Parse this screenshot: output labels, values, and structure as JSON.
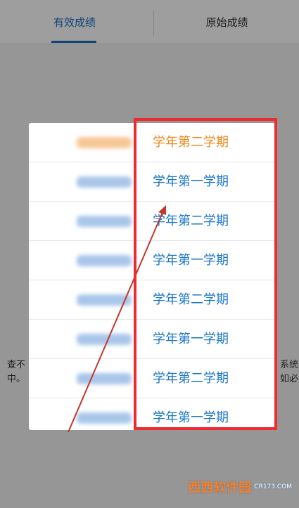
{
  "tabs": [
    {
      "label": "有效成绩",
      "active": true
    },
    {
      "label": "原始成绩",
      "active": false
    }
  ],
  "background_text": {
    "left": "查不\n中。",
    "right": "系统\n如必"
  },
  "picker": {
    "items": [
      {
        "term": "学年第二学期",
        "selected": true
      },
      {
        "term": "学年第一学期",
        "selected": false
      },
      {
        "term": "学年第二学期",
        "selected": false
      },
      {
        "term": "学年第一学期",
        "selected": false
      },
      {
        "term": "学年第二学期",
        "selected": false
      },
      {
        "term": "学年第一学期",
        "selected": false
      },
      {
        "term": "学年第二学期",
        "selected": false
      },
      {
        "term": "学年第一学期",
        "selected": false
      }
    ]
  },
  "watermark": {
    "brand": "西西软件园",
    "url": "CR173.COM"
  },
  "colors": {
    "accent": "#1a6fc0",
    "selected": "#ef8a1c",
    "highlight": "#ee2b30"
  }
}
